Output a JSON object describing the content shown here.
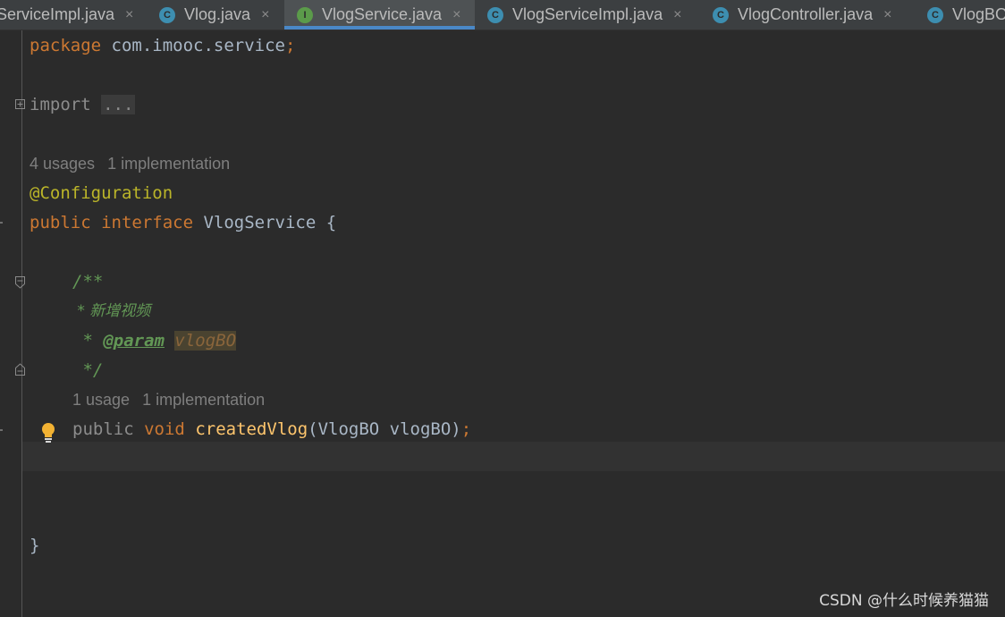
{
  "tabs": [
    {
      "label": "ServiceImpl.java",
      "icon": "class",
      "active": false
    },
    {
      "label": "Vlog.java",
      "icon": "class",
      "active": false
    },
    {
      "label": "VlogService.java",
      "icon": "interface",
      "active": true
    },
    {
      "label": "VlogServiceImpl.java",
      "icon": "class",
      "active": false
    },
    {
      "label": "VlogController.java",
      "icon": "class",
      "active": false
    },
    {
      "label": "VlogBO",
      "icon": "class",
      "active": false
    }
  ],
  "tab_icon_letters": {
    "class": "C",
    "interface": "I"
  },
  "close_glyph": "×",
  "code": {
    "package_kw": "package",
    "package_name": " com.imooc.service",
    "semicolon": ";",
    "import_kw": "import",
    "import_fold": "...",
    "hint1_usages": "4 usages",
    "hint1_impl": "1 implementation",
    "annotation": "@Configuration",
    "public_kw": "public",
    "interface_kw": "interface",
    "interface_name": " VlogService {",
    "doc_open": "/**",
    "doc_line1": " * 新增视频",
    "doc_star": " * ",
    "doc_param_tag": "@param",
    "doc_param_name": "vlogBO",
    "doc_close": " */",
    "hint2_usages": "1 usage",
    "hint2_impl": "1 implementation",
    "method_public": "public",
    "method_void": "void",
    "method_name": "createdVlog",
    "method_params": "(VlogBO vlogBO)",
    "method_semicolon": ";",
    "closing_brace": "}"
  },
  "watermark": "CSDN @什么时候养猫猫",
  "colors": {
    "background": "#2b2b2b",
    "keyword": "#cc7832",
    "annotation": "#bbb529",
    "doc_comment": "#629755",
    "method": "#ffc66d",
    "text": "#a9b7c6",
    "tab_active_underline": "#4a88c7"
  }
}
